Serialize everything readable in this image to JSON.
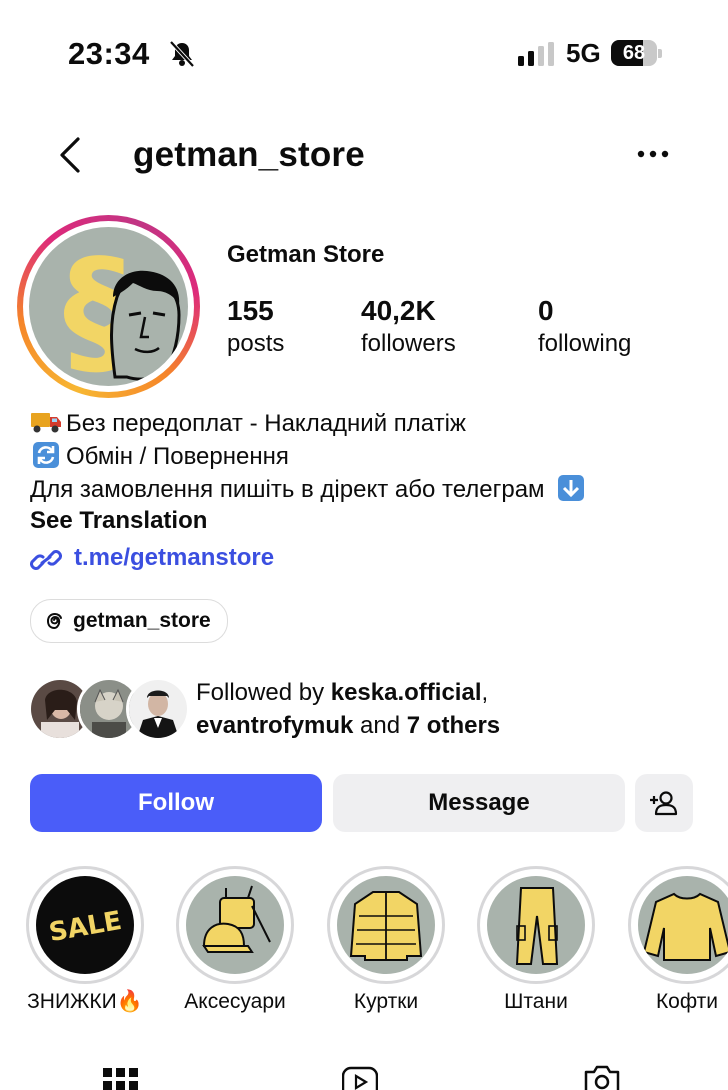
{
  "status": {
    "time": "23:34",
    "network": "5G",
    "battery": "68"
  },
  "header": {
    "username": "getman_store"
  },
  "profile": {
    "display_name": "Getman Store",
    "stats": [
      {
        "value": "155",
        "label": "posts"
      },
      {
        "value": "40,2K",
        "label": "followers"
      },
      {
        "value": "0",
        "label": "following"
      }
    ],
    "bio": [
      "Без передоплат - Накладний платіж",
      "Обмін / Повернення",
      "Для замовлення пишіть в дірект або телеграм"
    ],
    "see_translation": "See Translation",
    "link": "t.me/getmanstore",
    "threads_handle": "getman_store"
  },
  "followed_by": {
    "prefix": "Followed by ",
    "user1": "keska.official",
    "sep": ",",
    "user2": "evantrofymuk",
    "and": " and ",
    "others": "7 others"
  },
  "actions": {
    "follow": "Follow",
    "message": "Message"
  },
  "highlights": [
    {
      "label": "ЗНИЖКИ🔥",
      "cover": "SALE"
    },
    {
      "label": "Аксесуари"
    },
    {
      "label": "Куртки"
    },
    {
      "label": "Штани"
    },
    {
      "label": "Кофти"
    }
  ],
  "colors": {
    "accent": "#4a5df9",
    "link": "#3b4fe0",
    "brand_yellow": "#f2d565",
    "brand_gray": "#a9b3ac"
  }
}
